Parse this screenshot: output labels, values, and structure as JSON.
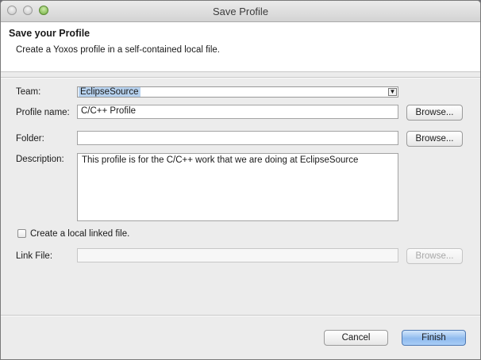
{
  "window": {
    "title": "Save Profile"
  },
  "banner": {
    "title": "Save your Profile",
    "description": "Create a Yoxos profile in a self-contained local file."
  },
  "form": {
    "team_label": "Team:",
    "team_value": "EclipseSource",
    "profile_name_label": "Profile name:",
    "profile_name_value": "C/C++ Profile",
    "folder_label": "Folder:",
    "folder_value": "",
    "description_label": "Description:",
    "description_value": "This profile is for the C/C++ work that we are doing at EclipseSource",
    "linked_checkbox_label": "Create a local linked file.",
    "linked_checked": false,
    "link_file_label": "Link File:",
    "link_file_value": "",
    "browse_label": "Browse..."
  },
  "footer": {
    "cancel_label": "Cancel",
    "finish_label": "Finish"
  }
}
